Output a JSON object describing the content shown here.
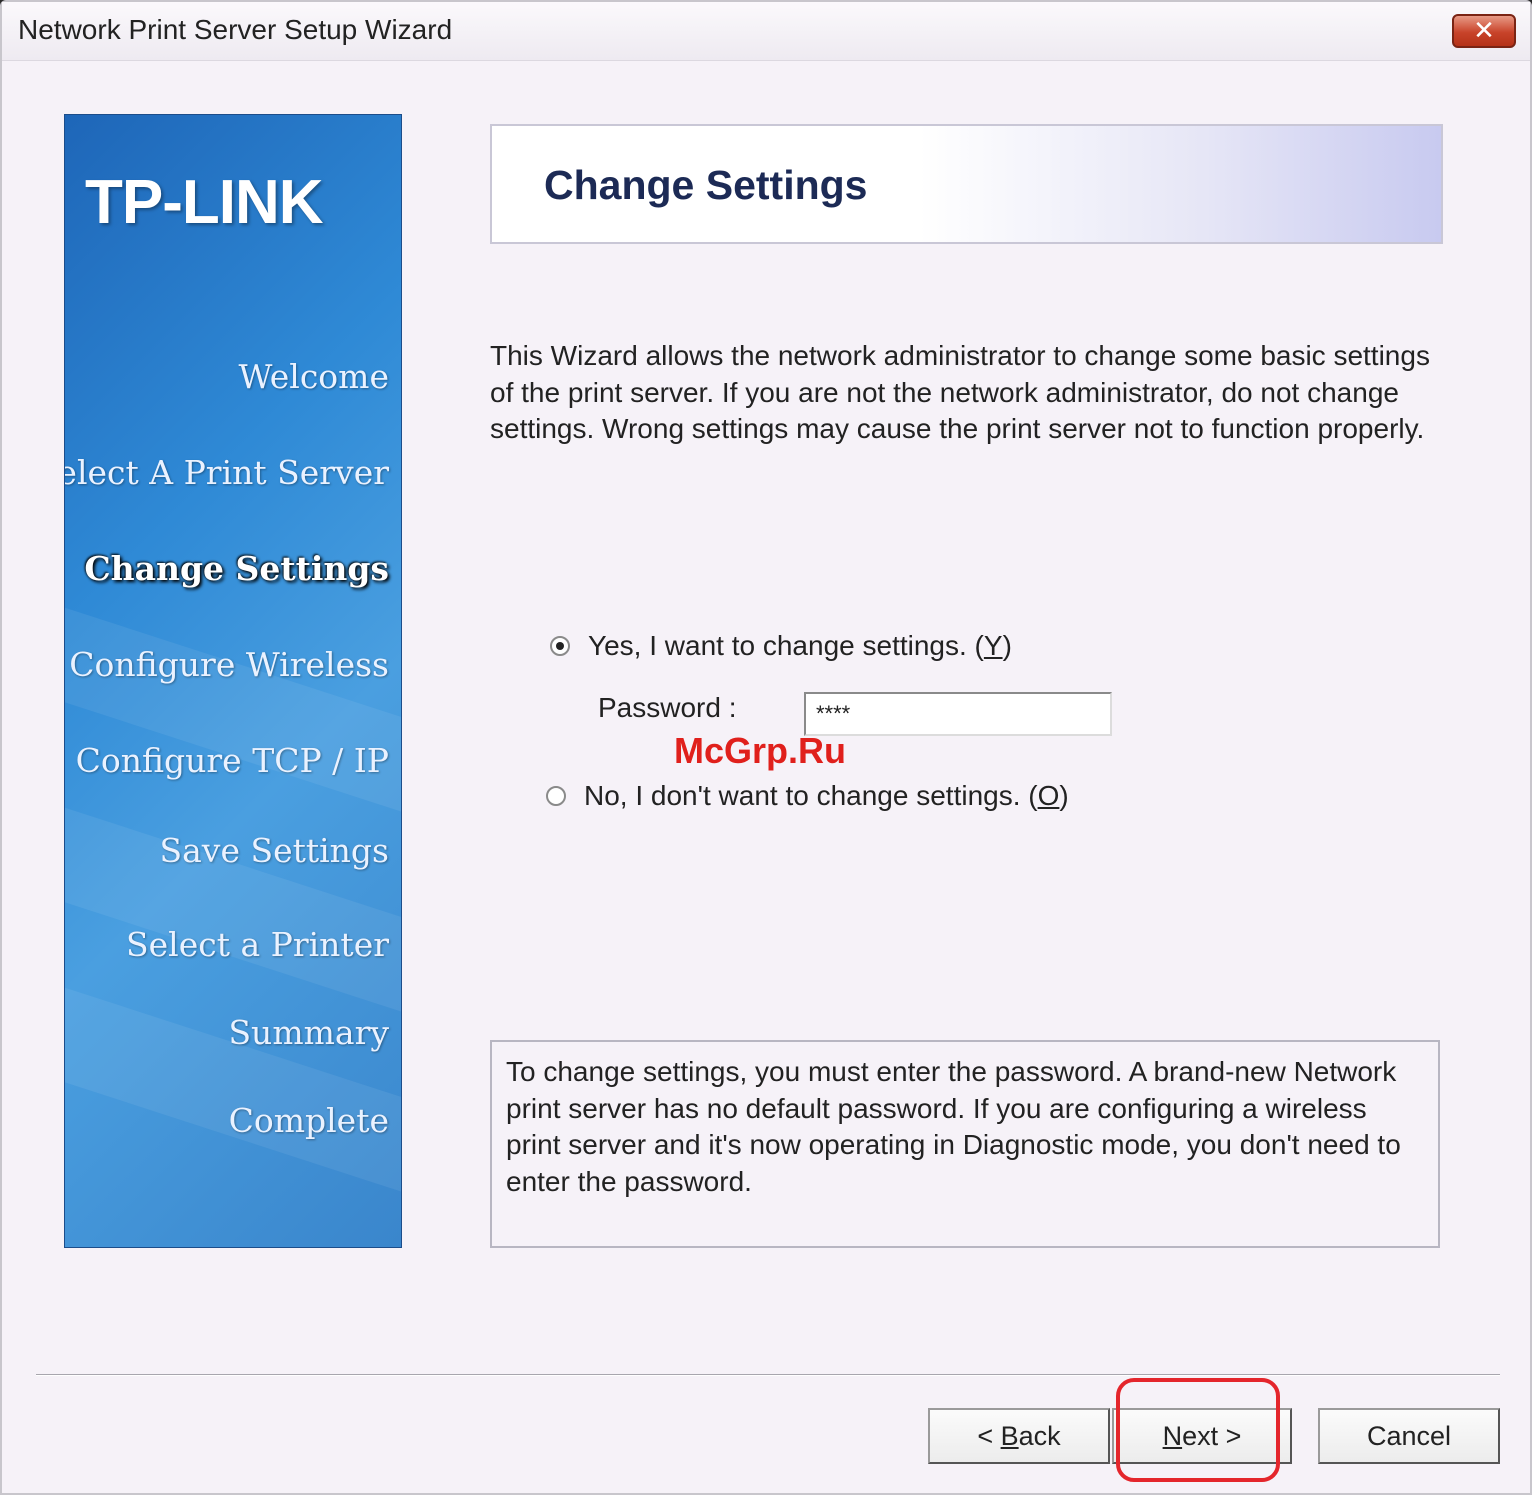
{
  "window": {
    "title": "Network Print Server Setup Wizard",
    "close_label": "✕"
  },
  "sidebar": {
    "logo": "TP-LINK",
    "items": [
      {
        "label": "Welcome",
        "active": false
      },
      {
        "label": "Select A Print Server",
        "active": false
      },
      {
        "label": "Change Settings",
        "active": true
      },
      {
        "label": "Configure Wireless",
        "active": false
      },
      {
        "label": "Configure TCP / IP",
        "active": false
      },
      {
        "label": "Save Settings",
        "active": false
      },
      {
        "label": "Select a Printer",
        "active": false
      },
      {
        "label": "Summary",
        "active": false
      },
      {
        "label": "Complete",
        "active": false
      }
    ]
  },
  "header": {
    "title": "Change Settings"
  },
  "main": {
    "description": "This Wizard allows the network administrator to change some basic settings of the print server. If you are not the network administrator, do not change settings. Wrong settings may cause the print server not to function properly.",
    "option_yes": {
      "text": "Yes, I want to change settings. (",
      "key": "Y",
      "end": ")",
      "checked": true
    },
    "option_no": {
      "text": "No, I don't want to change settings. (",
      "key": "O",
      "end": ")",
      "checked": false
    },
    "password_label": "Password :",
    "password_value": "****",
    "info": "To change settings, you must enter the password. A brand-new Network print server has no default password. If you are configuring a wireless print server and it's now operating in Diagnostic mode, you don't need to enter the password."
  },
  "watermark": "McGrp.Ru",
  "buttons": {
    "back_prefix": "< ",
    "back_key": "B",
    "back_rest": "ack",
    "next_key": "N",
    "next_rest": "ext >",
    "cancel": "Cancel"
  },
  "colors": {
    "sidebar_blue": "#2f8ad6",
    "highlight_red": "#e4262c"
  }
}
